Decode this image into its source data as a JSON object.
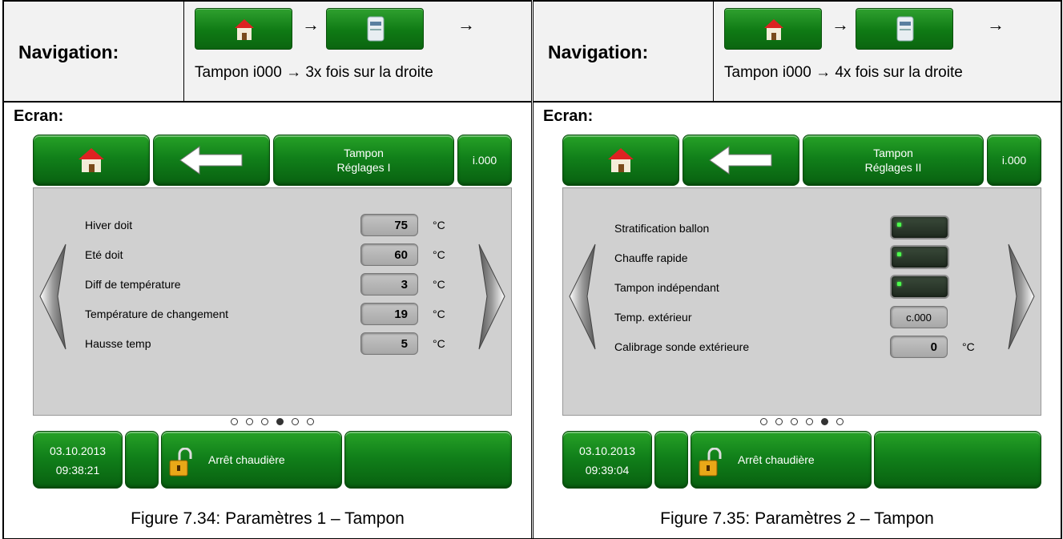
{
  "panels": [
    {
      "navigation_label": "Navigation:",
      "nav_arrow": "→",
      "nav_text": "Tampon i000 → 3x fois sur la droite",
      "ecran_label": "Ecran:",
      "header": {
        "home_icon": "house-icon",
        "back_icon": "arrow-left-icon",
        "title_line1": "Tampon",
        "title_line2": "Réglages I",
        "code": "i.000"
      },
      "rows": [
        {
          "label": "Hiver doit",
          "value": "75",
          "unit": "°C"
        },
        {
          "label": "Eté doit",
          "value": "60",
          "unit": "°C"
        },
        {
          "label": "Diff de température",
          "value": "3",
          "unit": "°C"
        },
        {
          "label": "Température de changement",
          "value": "19",
          "unit": "°C"
        },
        {
          "label": "Hausse temp",
          "value": "5",
          "unit": "°C"
        }
      ],
      "page_dots": {
        "total": 6,
        "active": 4
      },
      "footer": {
        "date": "03.10.2013",
        "time": "09:38:21",
        "status": "Arrêt chaudière"
      },
      "caption": "Figure 7.34: Paramètres 1 – Tampon"
    },
    {
      "navigation_label": "Navigation:",
      "nav_arrow": "→",
      "nav_text": "Tampon i000 → 4x fois sur la droite",
      "ecran_label": "Ecran:",
      "header": {
        "home_icon": "house-icon",
        "back_icon": "arrow-left-icon",
        "title_line1": "Tampon",
        "title_line2": "Réglages II",
        "code": "i.000"
      },
      "rows": [
        {
          "label": "Stratification ballon",
          "type": "toggle",
          "state": "on"
        },
        {
          "label": "Chauffe rapide",
          "type": "toggle",
          "state": "on"
        },
        {
          "label": "Tampon indépendant",
          "type": "toggle",
          "state": "on"
        },
        {
          "label": "Temp. extérieur",
          "value": "c.000"
        },
        {
          "label": "Calibrage sonde extérieure",
          "value": "0",
          "unit": "°C"
        }
      ],
      "page_dots": {
        "total": 6,
        "active": 5
      },
      "footer": {
        "date": "03.10.2013",
        "time": "09:39:04",
        "status": "Arrêt chaudière"
      },
      "caption": "Figure 7.35: Paramètres 2 – Tampon"
    }
  ]
}
